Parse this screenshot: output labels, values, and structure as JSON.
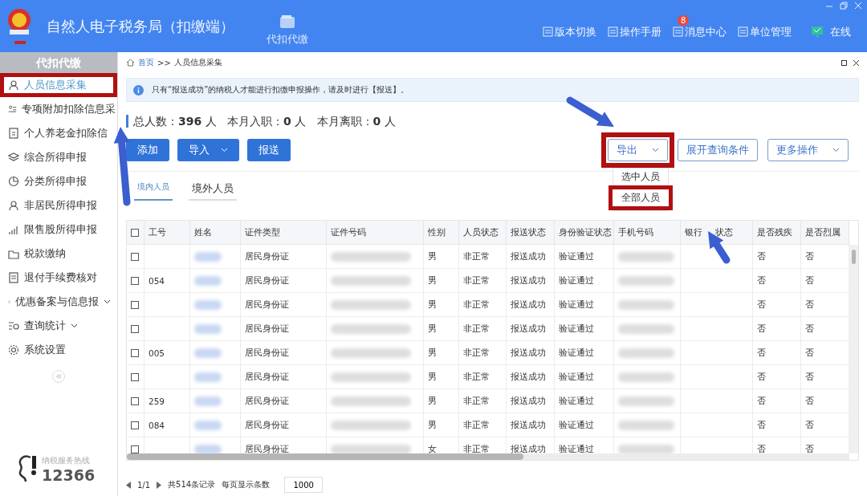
{
  "header": {
    "title": "自然人电子税务局（扣缴端）",
    "module": "代扣代缴",
    "menu": [
      {
        "label": "版本切换"
      },
      {
        "label": "操作手册"
      },
      {
        "label": "消息中心",
        "badge": "8"
      },
      {
        "label": "单位管理"
      }
    ],
    "status": "在线"
  },
  "sidebar": {
    "title": "代扣代缴",
    "items": [
      {
        "label": "人员信息采集",
        "selected": true,
        "highlighted": true,
        "expandable": false
      },
      {
        "label": "专项附加扣除信息采",
        "selected": false,
        "highlighted": false,
        "expandable": false
      },
      {
        "label": "个人养老金扣除信",
        "selected": false,
        "highlighted": false,
        "expandable": false
      },
      {
        "label": "综合所得申报",
        "selected": false,
        "highlighted": false,
        "expandable": false
      },
      {
        "label": "分类所得申报",
        "selected": false,
        "highlighted": false,
        "expandable": false
      },
      {
        "label": "非居民所得申报",
        "selected": false,
        "highlighted": false,
        "expandable": false
      },
      {
        "label": "限售股所得申报",
        "selected": false,
        "highlighted": false,
        "expandable": false
      },
      {
        "label": "税款缴纳",
        "selected": false,
        "highlighted": false,
        "expandable": false
      },
      {
        "label": "退付手续费核对",
        "selected": false,
        "highlighted": false,
        "expandable": false
      },
      {
        "label": "优惠备案与信息报",
        "selected": false,
        "highlighted": false,
        "expandable": true
      },
      {
        "label": "查询统计",
        "selected": false,
        "highlighted": false,
        "expandable": true
      },
      {
        "label": "系统设置",
        "selected": false,
        "highlighted": false,
        "expandable": false
      }
    ],
    "hotline_label": "纳税服务热线",
    "hotline": "12366"
  },
  "breadcrumb": {
    "home": "首页",
    "separator": ">>",
    "current": "人员信息采集"
  },
  "notice": "只有“报送成功”的纳税人才能进行扣缴申报操作，请及时进行【报送】。",
  "stats": "总人数：**396** 人   本月入职：**0** 人   本月离职：**0** 人",
  "actions": [
    {
      "label": "添加",
      "dropdown": false
    },
    {
      "label": "导入",
      "dropdown": true
    },
    {
      "label": "报送",
      "dropdown": false
    }
  ],
  "right_actions": [
    {
      "label": "导出",
      "dropdown": true,
      "highlighted": true
    },
    {
      "label": "展开查询条件",
      "dropdown": false,
      "highlighted": false
    },
    {
      "label": "更多操作",
      "dropdown": true,
      "highlighted": false
    }
  ],
  "export_menu": [
    {
      "label": "选中人员",
      "highlighted": false
    },
    {
      "label": "全部人员",
      "highlighted": true
    }
  ],
  "tabs": [
    {
      "label": "境内人员",
      "selected": true
    },
    {
      "label": "境外人员",
      "selected": false
    }
  ],
  "table": {
    "all_checked": false,
    "columns": [
      {
        "label": "工号",
        "kind": "text"
      },
      {
        "label": "姓名",
        "kind": "blurred"
      },
      {
        "label": "证件类型",
        "kind": "text"
      },
      {
        "label": "证件号码",
        "kind": "blurred"
      },
      {
        "label": "性别",
        "kind": "text"
      },
      {
        "label": "人员状态",
        "kind": "text"
      },
      {
        "label": "报送状态",
        "kind": "text"
      },
      {
        "label": "身份验证状态",
        "kind": "text"
      },
      {
        "label": "手机号码",
        "kind": "blurred"
      },
      {
        "label": "银行",
        "label_after": "状态",
        "kind": "text"
      },
      {
        "label": "是否残疾",
        "kind": "text"
      },
      {
        "label": "是否烈属",
        "kind": "text"
      }
    ],
    "rows": [
      {
        "checked": false,
        "cells": [
          "",
          "",
          "居民身份证",
          "",
          "男",
          "非正常",
          "报送成功",
          "验证通过",
          "",
          "",
          "否",
          "否"
        ]
      },
      {
        "checked": false,
        "cells": [
          "054",
          "",
          "居民身份证",
          "",
          "男",
          "非正常",
          "报送成功",
          "验证通过",
          "",
          "",
          "否",
          "否"
        ]
      },
      {
        "checked": false,
        "cells": [
          "",
          "",
          "居民身份证",
          "",
          "男",
          "非正常",
          "报送成功",
          "验证通过",
          "",
          "",
          "否",
          "否"
        ]
      },
      {
        "checked": false,
        "cells": [
          "",
          "",
          "居民身份证",
          "",
          "男",
          "非正常",
          "报送成功",
          "验证通过",
          "",
          "",
          "否",
          "否"
        ]
      },
      {
        "checked": false,
        "cells": [
          "005",
          "",
          "居民身份证",
          "",
          "男",
          "非正常",
          "报送成功",
          "验证通过",
          "",
          "",
          "否",
          "否"
        ]
      },
      {
        "checked": false,
        "cells": [
          "",
          "",
          "居民身份证",
          "",
          "男",
          "非正常",
          "报送成功",
          "验证通过",
          "",
          "",
          "否",
          "否"
        ]
      },
      {
        "checked": false,
        "cells": [
          "259",
          "",
          "居民身份证",
          "",
          "男",
          "非正常",
          "报送成功",
          "验证通过",
          "",
          "",
          "否",
          "否"
        ]
      },
      {
        "checked": false,
        "cells": [
          "084",
          "",
          "居民身份证",
          "",
          "男",
          "非正常",
          "报送成功",
          "验证通过",
          "",
          "",
          "否",
          "否"
        ]
      },
      {
        "checked": false,
        "cells": [
          "",
          "",
          "居民身份证",
          "",
          "女",
          "非正常",
          "报送成功",
          "验证通过",
          "",
          "",
          "否",
          "否"
        ]
      }
    ]
  },
  "pagination": {
    "pages": "1/1",
    "total": "共514条记录",
    "per_page_label": "每页显示条数",
    "per_page": "1000"
  },
  "annotations": [
    {
      "kind": "arrow"
    },
    {
      "kind": "arrow"
    },
    {
      "kind": "arrow"
    }
  ]
}
